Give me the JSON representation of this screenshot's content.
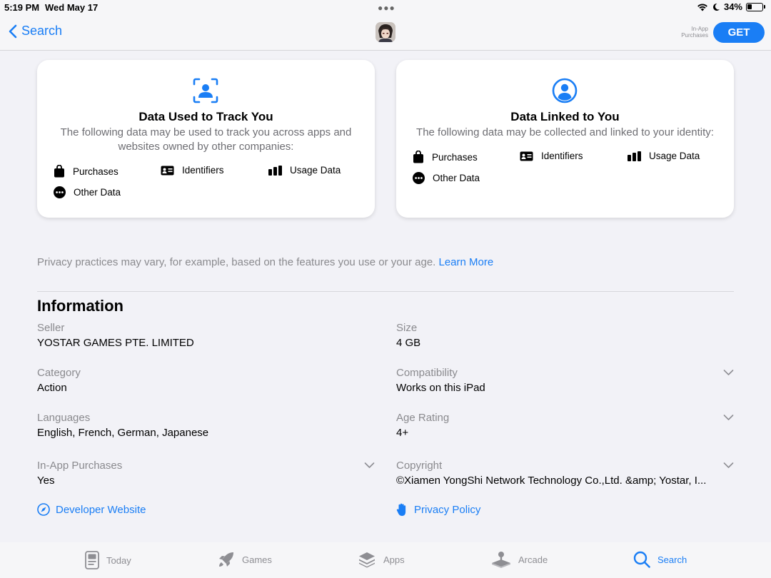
{
  "status_bar": {
    "time": "5:19 PM",
    "date": "Wed May 17",
    "battery": "34%",
    "battery_level": 0.34
  },
  "nav": {
    "back_label": "Search",
    "in_app_label": "In-App Purchases",
    "get_label": "GET",
    "accent_color": "#1a7ef5"
  },
  "privacy_cards": [
    {
      "icon": "tracking-face-icon",
      "title": "Data Used to Track You",
      "description": "The following data may be used to track you across apps and websites owned by other companies:",
      "items": [
        {
          "icon": "shopping-bag-icon",
          "label": "Purchases"
        },
        {
          "icon": "id-card-icon",
          "label": "Identifiers"
        },
        {
          "icon": "bar-chart-icon",
          "label": "Usage Data"
        },
        {
          "icon": "ellipsis-circle-icon",
          "label": "Other Data"
        }
      ]
    },
    {
      "icon": "person-circle-icon",
      "title": "Data Linked to You",
      "description": "The following data may be collected and linked to your identity:",
      "items": [
        {
          "icon": "shopping-bag-icon",
          "label": "Purchases"
        },
        {
          "icon": "id-card-icon",
          "label": "Identifiers"
        },
        {
          "icon": "bar-chart-icon",
          "label": "Usage Data"
        },
        {
          "icon": "ellipsis-circle-icon",
          "label": "Other Data"
        }
      ]
    }
  ],
  "privacy_note": {
    "text": "Privacy practices may vary, for example, based on the features you use or your age.",
    "link": "Learn More"
  },
  "information": {
    "title": "Information",
    "seller": {
      "label": "Seller",
      "value": "YOSTAR GAMES PTE. LIMITED"
    },
    "size": {
      "label": "Size",
      "value": "4 GB"
    },
    "category": {
      "label": "Category",
      "value": "Action"
    },
    "compatibility": {
      "label": "Compatibility",
      "value": "Works on this iPad"
    },
    "languages": {
      "label": "Languages",
      "value": "English, French, German, Japanese"
    },
    "age_rating": {
      "label": "Age Rating",
      "value": "4+"
    },
    "in_app_purchases": {
      "label": "In-App Purchases",
      "value": "Yes"
    },
    "copyright": {
      "label": "Copyright",
      "value": "©Xiamen YongShi Network Technology Co.,Ltd. &amp; Yostar, I..."
    },
    "developer_website": "Developer Website",
    "privacy_policy": "Privacy Policy"
  },
  "tabs": [
    {
      "icon": "today-icon",
      "label": "Today"
    },
    {
      "icon": "rocket-icon",
      "label": "Games"
    },
    {
      "icon": "apps-stack-icon",
      "label": "Apps"
    },
    {
      "icon": "joystick-icon",
      "label": "Arcade"
    },
    {
      "icon": "search-icon",
      "label": "Search"
    }
  ]
}
